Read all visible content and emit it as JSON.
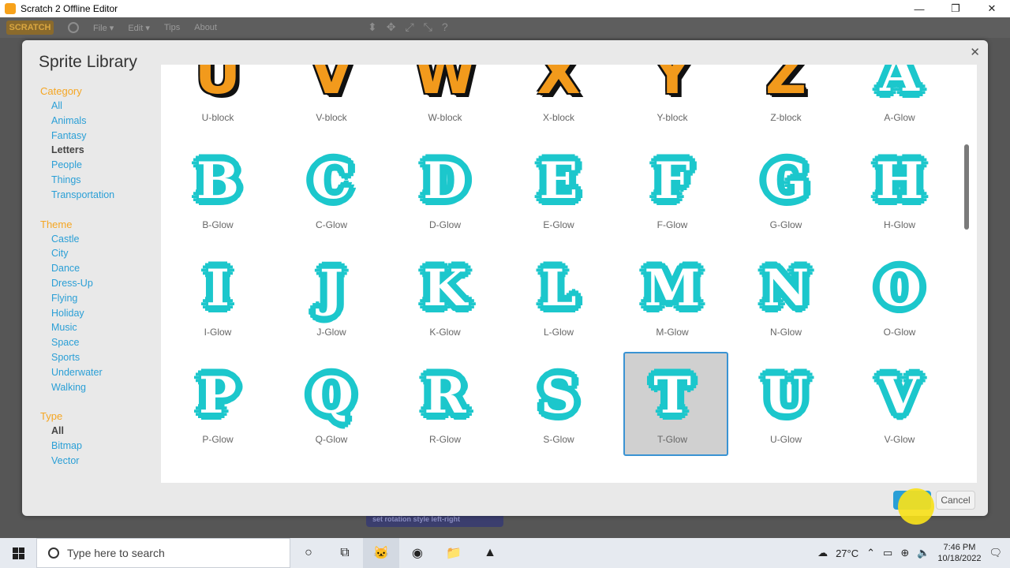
{
  "window": {
    "title": "Scratch 2 Offline Editor",
    "minimize": "—",
    "maximize": "❐",
    "close": "✕"
  },
  "menubar": {
    "logo": "SCRATCH",
    "file": "File ▾",
    "edit": "Edit ▾",
    "tips": "Tips",
    "about": "About",
    "tools": [
      "⬍",
      "✥",
      "⤢",
      "⤡",
      "?"
    ]
  },
  "editor": {
    "block_text": "set rotation style  left-right"
  },
  "dialog": {
    "title": "Sprite Library",
    "close": "✕",
    "ok_color": "#2a9fd6",
    "cancel_label": "Cancel",
    "category": {
      "heading": "Category",
      "items": [
        {
          "label": "All",
          "active": false
        },
        {
          "label": "Animals",
          "active": false
        },
        {
          "label": "Fantasy",
          "active": false
        },
        {
          "label": "Letters",
          "active": true
        },
        {
          "label": "People",
          "active": false
        },
        {
          "label": "Things",
          "active": false
        },
        {
          "label": "Transportation",
          "active": false
        }
      ]
    },
    "theme": {
      "heading": "Theme",
      "items": [
        {
          "label": "Castle"
        },
        {
          "label": "City"
        },
        {
          "label": "Dance"
        },
        {
          "label": "Dress-Up"
        },
        {
          "label": "Flying"
        },
        {
          "label": "Holiday"
        },
        {
          "label": "Music"
        },
        {
          "label": "Space"
        },
        {
          "label": "Sports"
        },
        {
          "label": "Underwater"
        },
        {
          "label": "Walking"
        }
      ]
    },
    "type": {
      "heading": "Type",
      "items": [
        {
          "label": "All",
          "active": true
        },
        {
          "label": "Bitmap",
          "active": false
        },
        {
          "label": "Vector",
          "active": false
        }
      ]
    },
    "sprites": [
      {
        "name": "U-block",
        "letter": "U",
        "style": "block",
        "selected": false
      },
      {
        "name": "V-block",
        "letter": "V",
        "style": "block",
        "selected": false
      },
      {
        "name": "W-block",
        "letter": "W",
        "style": "block",
        "selected": false
      },
      {
        "name": "X-block",
        "letter": "X",
        "style": "block",
        "selected": false
      },
      {
        "name": "Y-block",
        "letter": "Y",
        "style": "block",
        "selected": false
      },
      {
        "name": "Z-block",
        "letter": "Z",
        "style": "block",
        "selected": false
      },
      {
        "name": "A-Glow",
        "letter": "A",
        "style": "glow",
        "selected": false
      },
      {
        "name": "B-Glow",
        "letter": "B",
        "style": "glow",
        "selected": false
      },
      {
        "name": "C-Glow",
        "letter": "C",
        "style": "glow",
        "selected": false
      },
      {
        "name": "D-Glow",
        "letter": "D",
        "style": "glow",
        "selected": false
      },
      {
        "name": "E-Glow",
        "letter": "E",
        "style": "glow",
        "selected": false
      },
      {
        "name": "F-Glow",
        "letter": "F",
        "style": "glow",
        "selected": false
      },
      {
        "name": "G-Glow",
        "letter": "G",
        "style": "glow",
        "selected": false
      },
      {
        "name": "H-Glow",
        "letter": "H",
        "style": "glow",
        "selected": false
      },
      {
        "name": "I-Glow",
        "letter": "I",
        "style": "glow",
        "selected": false
      },
      {
        "name": "J-Glow",
        "letter": "J",
        "style": "glow",
        "selected": false
      },
      {
        "name": "K-Glow",
        "letter": "K",
        "style": "glow",
        "selected": false
      },
      {
        "name": "L-Glow",
        "letter": "L",
        "style": "glow",
        "selected": false
      },
      {
        "name": "M-Glow",
        "letter": "M",
        "style": "glow",
        "selected": false
      },
      {
        "name": "N-Glow",
        "letter": "N",
        "style": "glow",
        "selected": false
      },
      {
        "name": "O-Glow",
        "letter": "O",
        "style": "glow",
        "selected": false
      },
      {
        "name": "P-Glow",
        "letter": "P",
        "style": "glow",
        "selected": false
      },
      {
        "name": "Q-Glow",
        "letter": "Q",
        "style": "glow",
        "selected": false
      },
      {
        "name": "R-Glow",
        "letter": "R",
        "style": "glow",
        "selected": false
      },
      {
        "name": "S-Glow",
        "letter": "S",
        "style": "glow",
        "selected": false
      },
      {
        "name": "T-Glow",
        "letter": "T",
        "style": "glow",
        "selected": true
      },
      {
        "name": "U-Glow",
        "letter": "U",
        "style": "glow",
        "selected": false
      },
      {
        "name": "V-Glow",
        "letter": "V",
        "style": "glow",
        "selected": false
      }
    ]
  },
  "taskbar": {
    "search_placeholder": "Type here to search",
    "weather": "27°C",
    "time": "7:46 PM",
    "date": "10/18/2022"
  }
}
